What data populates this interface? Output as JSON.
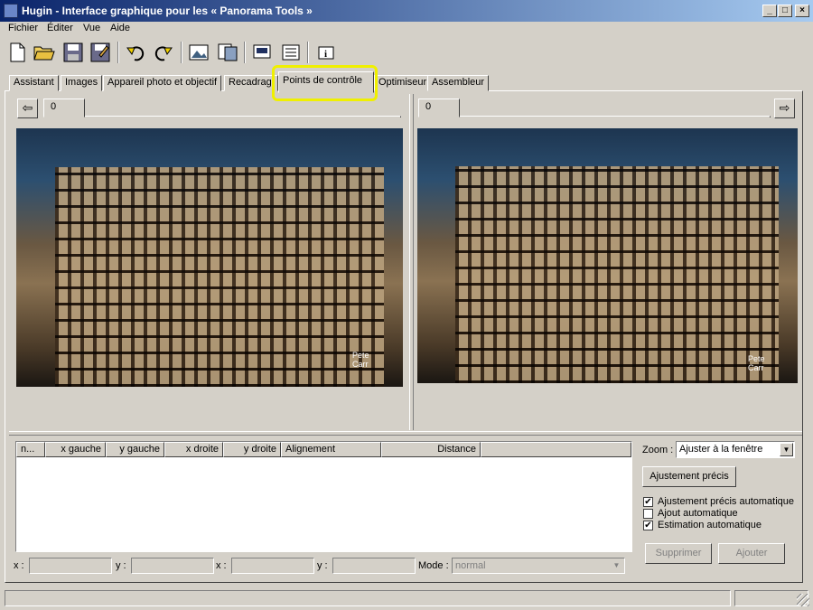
{
  "window": {
    "title": "Hugin - Interface graphique pour les « Panorama Tools »"
  },
  "menu": [
    "Fichier",
    "Éditer",
    "Vue",
    "Aide"
  ],
  "toolbar": [
    "new-icon",
    "open-icon",
    "save-icon",
    "save-as-icon",
    "undo-icon",
    "redo-icon",
    "images-icon",
    "camera-icon",
    "preview-icon",
    "list-icon",
    "info-icon"
  ],
  "tabs": [
    "Assistant",
    "Images",
    "Appareil photo et objectif",
    "Recadrag",
    "Points de contrôle",
    "Optimiseur",
    "Assembleur"
  ],
  "active_tab": "Points de contrôle",
  "left_panel": {
    "tab": "0",
    "nav_arrow": "⇦"
  },
  "right_panel": {
    "tab": "0",
    "nav_arrow": "⇨"
  },
  "image_label": "Pete\nCarr",
  "table": {
    "columns": [
      "n...",
      "x gauche",
      "y gauche",
      "x droite",
      "y droite",
      "Alignement",
      "Distance"
    ]
  },
  "zoom": {
    "label": "Zoom :",
    "value": "Ajuster à la fenêtre"
  },
  "buttons": {
    "fine_tune": "Ajustement précis",
    "delete": "Supprimer",
    "add": "Ajouter"
  },
  "checkboxes": [
    {
      "label": "Ajustement précis automatique",
      "checked": true
    },
    {
      "label": "Ajout automatique",
      "checked": false
    },
    {
      "label": "Estimation automatique",
      "checked": true
    }
  ],
  "coords": {
    "x1": "x :",
    "y1": "y :",
    "x2": "x :",
    "y2": "y :"
  },
  "mode": {
    "label": "Mode :",
    "value": "normal"
  },
  "colors": {
    "titlebar_start": "#0a246a",
    "titlebar_end": "#a6caf0",
    "highlight": "#f0f000"
  }
}
